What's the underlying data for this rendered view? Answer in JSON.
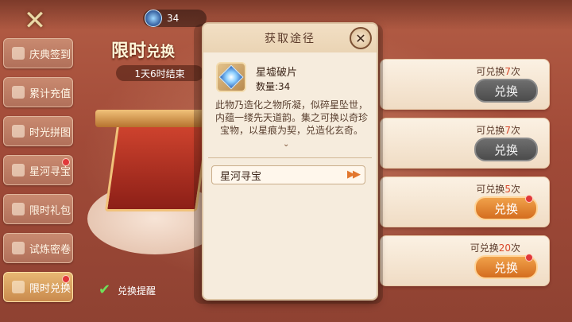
{
  "header": {
    "currency_value": "34"
  },
  "sidebar": {
    "items": [
      {
        "label": "庆典签到",
        "badge": false,
        "active": false
      },
      {
        "label": "累计充值",
        "badge": false,
        "active": false
      },
      {
        "label": "时光拼图",
        "badge": false,
        "active": false
      },
      {
        "label": "星河寻宝",
        "badge": true,
        "active": false
      },
      {
        "label": "限时礼包",
        "badge": false,
        "active": false
      },
      {
        "label": "试炼密卷",
        "badge": false,
        "active": false
      },
      {
        "label": "限时兑换",
        "badge": true,
        "active": true
      }
    ]
  },
  "main": {
    "title": "限时",
    "title_small": "兑换",
    "timer": "1天6时结束",
    "remind_label": "兑换提醒"
  },
  "exchange_cards": [
    {
      "prefix": "可兑换",
      "count": "7",
      "suffix": "次",
      "button": "兑换",
      "enabled": false,
      "badge": false
    },
    {
      "prefix": "可兑换",
      "count": "7",
      "suffix": "次",
      "button": "兑换",
      "enabled": false,
      "badge": false
    },
    {
      "prefix": "可兑换",
      "count": "5",
      "suffix": "次",
      "button": "兑换",
      "enabled": true,
      "badge": true
    },
    {
      "prefix": "可兑换",
      "count": "20",
      "suffix": "次",
      "button": "兑换",
      "enabled": true,
      "badge": true
    }
  ],
  "modal": {
    "title": "获取途径",
    "item_name": "星墟破片",
    "qty_label": "数量:",
    "qty_value": "34",
    "description": "此物乃造化之物所凝，似碎星坠世，内蕴一缕先天道韵。集之可换以奇珍宝物，以星痕为契，兑造化玄奇。",
    "source_label": "星河寻宝"
  }
}
